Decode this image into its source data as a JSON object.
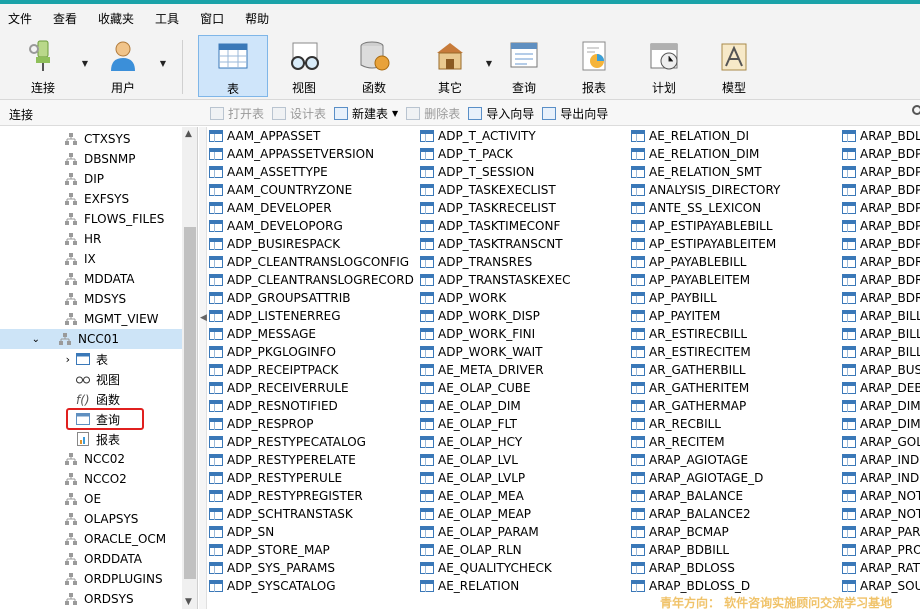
{
  "menu": [
    "文件",
    "查看",
    "收藏夹",
    "工具",
    "窗口",
    "帮助"
  ],
  "toolbar": {
    "connect": "连接",
    "user": "用户",
    "table": "表",
    "view": "视图",
    "function": "函数",
    "other": "其它",
    "query": "查询",
    "report": "报表",
    "schedule": "计划",
    "model": "模型"
  },
  "subbar": {
    "connection_label": "连接",
    "open_table": "打开表",
    "design_table": "设计表",
    "new_table": "新建表",
    "delete_table": "删除表",
    "import_wizard": "导入向导",
    "export_wizard": "导出向导"
  },
  "tree": {
    "schemas_before": [
      "CTXSYS",
      "DBSNMP",
      "DIP",
      "EXFSYS",
      "FLOWS_FILES",
      "HR",
      "IX",
      "MDDATA",
      "MDSYS",
      "MGMT_VIEW"
    ],
    "selected_schema": "NCC01",
    "children": [
      "表",
      "视图",
      "函数",
      "查询",
      "报表"
    ],
    "schemas_after": [
      "NCC02",
      "NCCO2",
      "OE",
      "OLAPSYS",
      "ORACLE_OCM",
      "ORDDATA",
      "ORDPLUGINS",
      "ORDSYS"
    ]
  },
  "tables": {
    "col1": [
      "AAM_APPASSET",
      "AAM_APPASSETVERSION",
      "AAM_ASSETTYPE",
      "AAM_COUNTRYZONE",
      "AAM_DEVELOPER",
      "AAM_DEVELOPORG",
      "ADP_BUSIRESPACK",
      "ADP_CLEANTRANSLOGCONFIG",
      "ADP_CLEANTRANSLOGRECORD",
      "ADP_GROUPSATTRIB",
      "ADP_LISTENERREG",
      "ADP_MESSAGE",
      "ADP_PKGLOGINFO",
      "ADP_RECEIPTPACK",
      "ADP_RECEIVERRULE",
      "ADP_RESNOTIFIED",
      "ADP_RESPROP",
      "ADP_RESTYPECATALOG",
      "ADP_RESTYPERELATE",
      "ADP_RESTYPERULE",
      "ADP_RESTYPREGISTER",
      "ADP_SCHTRANSTASK",
      "ADP_SN",
      "ADP_STORE_MAP",
      "ADP_SYS_PARAMS",
      "ADP_SYSCATALOG"
    ],
    "col2": [
      "ADP_T_ACTIVITY",
      "ADP_T_PACK",
      "ADP_T_SESSION",
      "ADP_TASKEXECLIST",
      "ADP_TASKRECELIST",
      "ADP_TASKTIMECONF",
      "ADP_TASKTRANSCNT",
      "ADP_TRANSRES",
      "ADP_TRANSTASKEXEC",
      "ADP_WORK",
      "ADP_WORK_DISP",
      "ADP_WORK_FINI",
      "ADP_WORK_WAIT",
      "AE_META_DRIVER",
      "AE_OLAP_CUBE",
      "AE_OLAP_DIM",
      "AE_OLAP_FLT",
      "AE_OLAP_HCY",
      "AE_OLAP_LVL",
      "AE_OLAP_LVLP",
      "AE_OLAP_MEA",
      "AE_OLAP_MEAP",
      "AE_OLAP_PARAM",
      "AE_OLAP_RLN",
      "AE_QUALITYCHECK",
      "AE_RELATION"
    ],
    "col3": [
      "AE_RELATION_DI",
      "AE_RELATION_DIM",
      "AE_RELATION_SMT",
      "ANALYSIS_DIRECTORY",
      "ANTE_SS_LEXICON",
      "AP_ESTIPAYABLEBILL",
      "AP_ESTIPAYABLEITEM",
      "AP_PAYABLEBILL",
      "AP_PAYABLEITEM",
      "AP_PAYBILL",
      "AP_PAYITEM",
      "AR_ESTIRECBILL",
      "AR_ESTIRECITEM",
      "AR_GATHERBILL",
      "AR_GATHERITEM",
      "AR_GATHERMAP",
      "AR_RECBILL",
      "AR_RECITEM",
      "ARAP_AGIOTAGE",
      "ARAP_AGIOTAGE_D",
      "ARAP_BALANCE",
      "ARAP_BALANCE2",
      "ARAP_BCMAP",
      "ARAP_BDBILL",
      "ARAP_BDLOSS",
      "ARAP_BDLOSS_D"
    ],
    "col4": [
      "ARAP_BDLI",
      "ARAP_BDP",
      "ARAP_BDP",
      "ARAP_BDP",
      "ARAP_BDP",
      "ARAP_BDP",
      "ARAP_BDP",
      "ARAP_BDR",
      "ARAP_BDR",
      "ARAP_BDR",
      "ARAP_BILL",
      "ARAP_BILL",
      "ARAP_BILL",
      "ARAP_BUS",
      "ARAP_DEB",
      "ARAP_DIM",
      "ARAP_DIM",
      "ARAP_GOL",
      "ARAP_IND",
      "ARAP_IND",
      "ARAP_NOT",
      "ARAP_NOT",
      "ARAP_PAR",
      "ARAP_PRO",
      "ARAP_RAT",
      "ARAP_SOU"
    ]
  },
  "watermark": "青年方向： 软件咨询实施顾问交流学习基地",
  "colors": {
    "accent": "#1aa2a8",
    "selection": "#cde4f7",
    "highlight_box": "#e0201f",
    "watermark": "#f0c36a"
  }
}
